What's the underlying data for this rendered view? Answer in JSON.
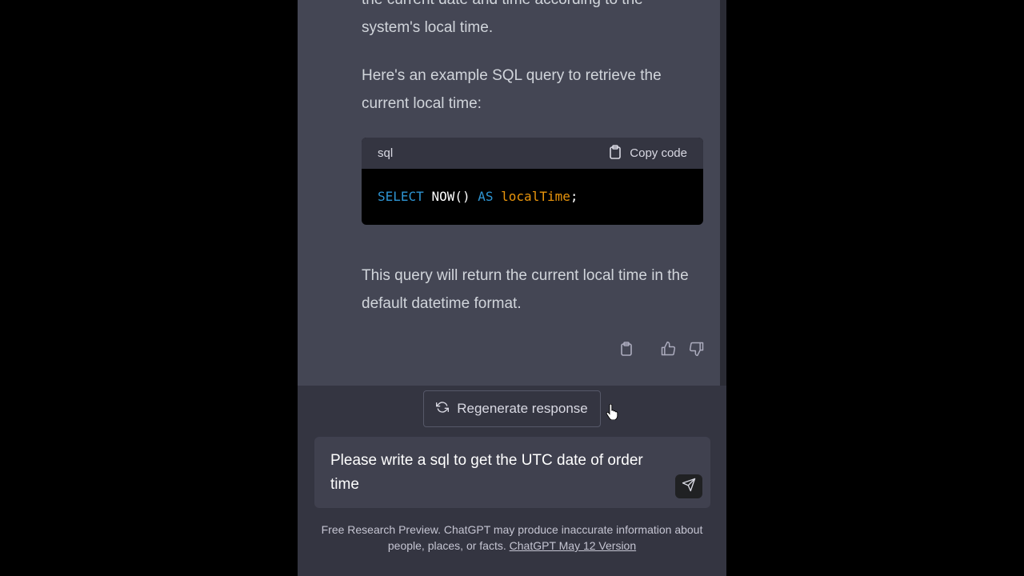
{
  "message": {
    "paragraph1_lines": [
      "the current date and time according to the",
      "system's local time."
    ],
    "paragraph2": "Here's an example SQL query to retrieve the current local time:",
    "code": {
      "language": "sql",
      "copy_label": "Copy code",
      "tokens": {
        "select": "SELECT",
        "func": "NOW()",
        "as": "AS",
        "alias": "localTime",
        "end": ";"
      }
    },
    "paragraph3": "This query will return the current local time in the default datetime format."
  },
  "icons": {
    "copy": "clipboard-icon",
    "thumbs_up": "thumbs-up-icon",
    "thumbs_down": "thumbs-down-icon",
    "regenerate": "refresh-icon",
    "send": "paper-plane-icon",
    "cursor": "hand-pointer-icon"
  },
  "regenerate_label": "Regenerate response",
  "input": {
    "value": "Please write a sql to get the UTC date of order time"
  },
  "footer": {
    "text": "Free Research Preview. ChatGPT may produce inaccurate information about people, places, or facts.",
    "link": "ChatGPT May 12 Version"
  },
  "colors": {
    "app_bg": "#343541",
    "message_bg": "#444654",
    "input_bg": "#40414f",
    "code_keyword": "#2e95d3",
    "code_alias": "#e9950c"
  }
}
